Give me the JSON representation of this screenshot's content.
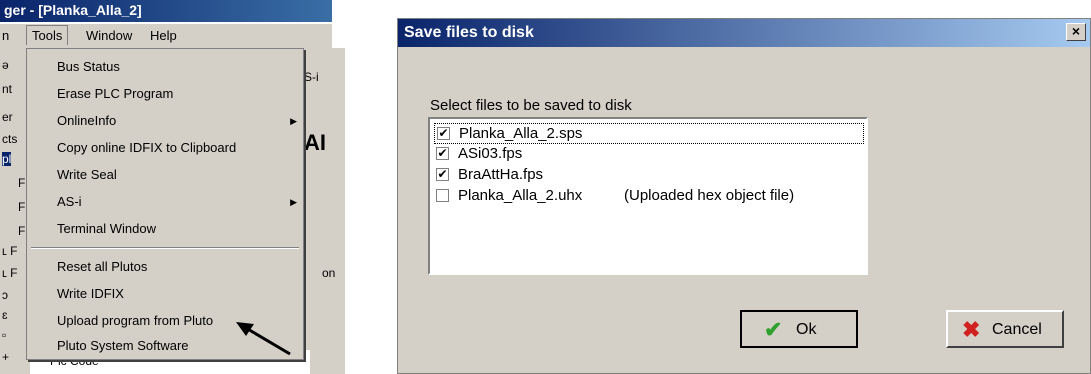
{
  "left": {
    "titlebar": "ger - [Planka_Alla_2]",
    "menubar": {
      "left_fragment": "n",
      "tools": "Tools",
      "window": "Window",
      "help": "Help"
    },
    "side_fragments": [
      "ə",
      "nt",
      "er",
      "cts",
      "pl",
      "F",
      "F",
      "F",
      "ʟ F",
      "ʟ F",
      "ɔ",
      "ɛ",
      "▫",
      "+"
    ],
    "right_fragments": [
      "S-i",
      "AI",
      "on"
    ],
    "bottom_text": "Pic Code",
    "menu_items": [
      {
        "label": "Bus Status",
        "submenu": false
      },
      {
        "label": "Erase PLC Program",
        "submenu": false
      },
      {
        "label": "OnlineInfo",
        "submenu": true
      },
      {
        "label": "Copy online IDFIX to Clipboard",
        "submenu": false
      },
      {
        "label": "Write Seal",
        "submenu": false
      },
      {
        "label": "AS-i",
        "submenu": true
      },
      {
        "label": "Terminal Window",
        "submenu": false
      },
      {
        "label": "Reset all Plutos",
        "submenu": false
      },
      {
        "label": "Write IDFIX",
        "submenu": false
      },
      {
        "label": "Upload program from Pluto",
        "submenu": false
      },
      {
        "label": "Pluto System Software",
        "submenu": false
      }
    ]
  },
  "dialog": {
    "title": "Save files to disk",
    "close": "×",
    "prompt": "Select files to be saved to disk",
    "files": [
      {
        "name": "Planka_Alla_2.sps",
        "checked": true,
        "desc": ""
      },
      {
        "name": "ASi03.fps",
        "checked": true,
        "desc": ""
      },
      {
        "name": "BraAttHa.fps",
        "checked": true,
        "desc": ""
      },
      {
        "name": "Planka_Alla_2.uhx",
        "checked": false,
        "desc": "(Uploaded hex object file)"
      }
    ],
    "ok_label": "Ok",
    "cancel_label": "Cancel",
    "check_mark": "✔",
    "ok_icon": "✔",
    "cancel_icon": "✖"
  },
  "colors": {
    "titlebar": "#0a246a",
    "ok_icon": "#2ea02e",
    "cancel_icon": "#d02020"
  }
}
